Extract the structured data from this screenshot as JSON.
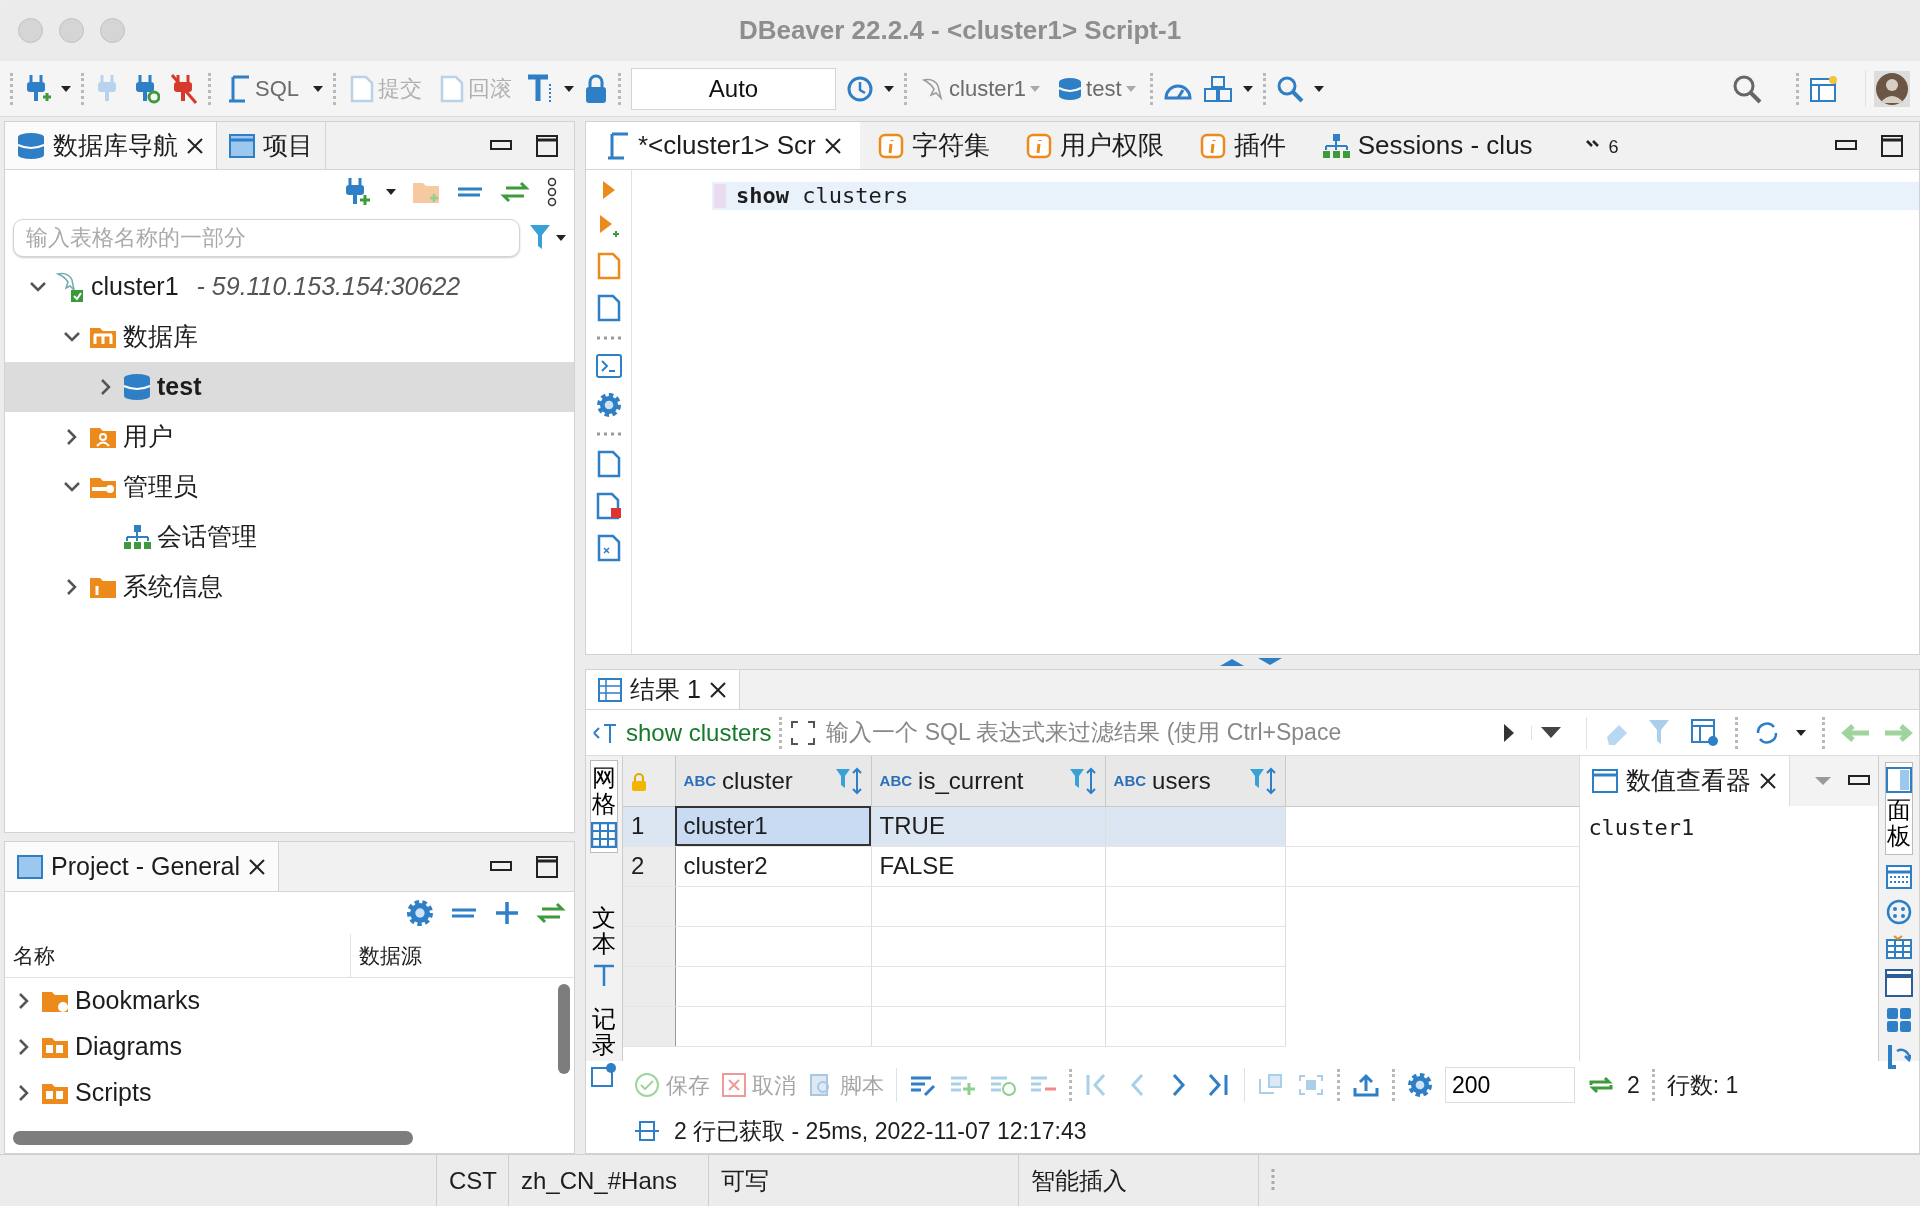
{
  "window": {
    "title": "DBeaver 22.2.4 - <cluster1> Script-1"
  },
  "toolbar": {
    "sql_button": "SQL",
    "commit_button": {
      "label": "提交",
      "disabled": true
    },
    "rollback_button": {
      "label": "回滚",
      "disabled": true
    },
    "transaction_mode": "Auto",
    "connection": "cluster1",
    "database": "test"
  },
  "navigator": {
    "tabs": [
      {
        "label": "数据库导航",
        "selected": true
      },
      {
        "label": "项目",
        "selected": false
      }
    ],
    "filter": {
      "placeholder": "输入表格名称的一部分"
    },
    "tree": [
      {
        "kind": "connection",
        "label": "cluster1",
        "detail": "- 59.110.153.154:30622",
        "expandable": true,
        "expanded": true,
        "selected": false,
        "children": [
          {
            "kind": "folder",
            "label": "数据库",
            "expandable": true,
            "expanded": true,
            "selected": false,
            "children": [
              {
                "kind": "database",
                "label": "test",
                "expandable": true,
                "expanded": false,
                "selected": true
              }
            ]
          },
          {
            "kind": "folder",
            "label": "用户",
            "expandable": true,
            "expanded": false,
            "selected": false
          },
          {
            "kind": "folder",
            "label": "管理员",
            "expandable": true,
            "expanded": true,
            "selected": false,
            "children": [
              {
                "kind": "sessions",
                "label": "会话管理",
                "expandable": false,
                "selected": false
              }
            ]
          },
          {
            "kind": "folder",
            "label": "系统信息",
            "expandable": true,
            "expanded": false,
            "selected": false
          }
        ]
      }
    ]
  },
  "project": {
    "tab": "Project - General",
    "columns": [
      "名称",
      "数据源"
    ],
    "items": [
      {
        "label": "Bookmarks",
        "expanded": false
      },
      {
        "label": "Diagrams",
        "expanded": false
      },
      {
        "label": "Scripts",
        "expanded": false
      }
    ]
  },
  "editor": {
    "tabs": [
      {
        "label": "*<cluster1> Scr",
        "selected": true
      },
      {
        "label": "字符集",
        "selected": false
      },
      {
        "label": "用户权限",
        "selected": false
      },
      {
        "label": "插件",
        "selected": false
      },
      {
        "label": "Sessions - clus",
        "selected": false
      }
    ],
    "hidden_tab_count": "6",
    "code_lines": [
      "**show** clusters"
    ]
  },
  "results": {
    "tab": "结果 1",
    "query": "show clusters",
    "filter": {
      "placeholder": "输入一个 SQL 表达式来过滤结果 (使用 Ctrl+Space"
    },
    "side_tabs": [
      {
        "label": "网格",
        "selected": true
      },
      {
        "label": "文本",
        "selected": false
      },
      {
        "label": "记录",
        "selected": false
      }
    ],
    "columns": [
      {
        "type_label": "ABC",
        "name": "cluster"
      },
      {
        "type_label": "ABC",
        "name": "is_current"
      },
      {
        "type_label": "ABC",
        "name": "users"
      }
    ],
    "rows": [
      {
        "number": "1",
        "selected": true,
        "cells": [
          {
            "text": "cluster1",
            "focused": true
          },
          {
            "text": "TRUE",
            "focused": false
          },
          {
            "focused": false
          }
        ]
      },
      {
        "number": "2",
        "selected": false,
        "cells": [
          {
            "text": "cluster2",
            "focused": false
          },
          {
            "text": "FALSE",
            "focused": false
          },
          {
            "focused": false
          }
        ]
      }
    ],
    "value_viewer": {
      "title": "数值查看器",
      "value": "cluster1"
    },
    "panel_tab": "面板",
    "actions": [
      {
        "label": "保存",
        "disabled": true
      },
      {
        "label": "取消",
        "disabled": true
      },
      {
        "label": "脚本",
        "disabled": true
      }
    ],
    "fetch_size": "200",
    "refresh_count": "2",
    "row_count": "行数: 1",
    "status": "2 行已获取 - 25ms, 2022-11-07 12:17:43"
  },
  "status_bar": [
    "CST",
    "zh_CN_#Hans",
    "可写",
    "智能插入"
  ]
}
